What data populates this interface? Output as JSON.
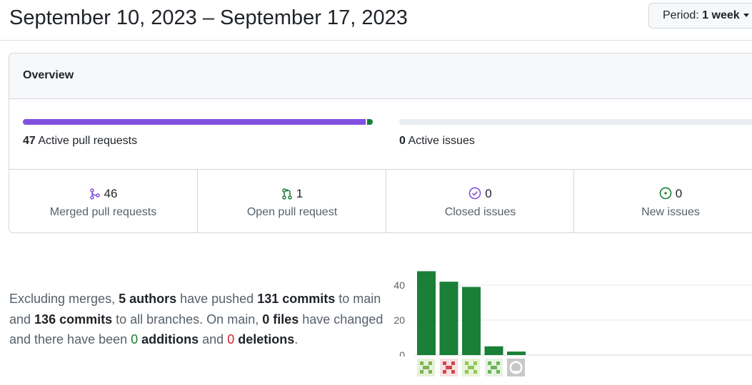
{
  "header": {
    "title": "September 10, 2023 – September 17, 2023",
    "period_label": "Period:",
    "period_value": "1 week"
  },
  "overview": {
    "title": "Overview",
    "pull_requests": {
      "count": "47",
      "label": "Active pull requests",
      "merged": 46,
      "open": 1
    },
    "issues": {
      "count": "0",
      "label": "Active issues"
    },
    "stats": [
      {
        "icon": "git-merge-icon",
        "color": "#8250df",
        "value": "46",
        "label": "Merged pull requests"
      },
      {
        "icon": "git-pull-request-icon",
        "color": "#1a7f37",
        "value": "1",
        "label": "Open pull request"
      },
      {
        "icon": "issue-closed-icon",
        "color": "#8250df",
        "value": "0",
        "label": "Closed issues"
      },
      {
        "icon": "issue-opened-icon",
        "color": "#1a7f37",
        "value": "0",
        "label": "New issues"
      }
    ]
  },
  "commits": {
    "p1": "Excluding merges, ",
    "authors": "5 authors",
    "p2": " have pushed ",
    "main_commits": "131 commits",
    "p3": " to main and ",
    "all_commits": "136 commits",
    "p4": " to all branches. On main, ",
    "files": "0 files",
    "p5": " have changed and there have been ",
    "additions_num": "0",
    "additions_word": " additions",
    "p6": " and ",
    "deletions_num": "0",
    "deletions_word": " deletions",
    "p7": "."
  },
  "chart_data": {
    "type": "bar",
    "series": [
      {
        "values": [
          48,
          42,
          39,
          5,
          2
        ]
      }
    ],
    "ylim": [
      0,
      50
    ],
    "yticks": [
      0,
      20,
      40
    ],
    "grid": true,
    "bar_color": "#1a7f37",
    "avatars": [
      {
        "name": "avatar-contributor-1",
        "bg": "#e6f2d6",
        "fg": "#7fb05a"
      },
      {
        "name": "avatar-contributor-2",
        "bg": "#f7e1e1",
        "fg": "#d2464a"
      },
      {
        "name": "avatar-contributor-3",
        "bg": "#e9f4d5",
        "fg": "#8fc45c"
      },
      {
        "name": "avatar-contributor-4",
        "bg": "#e6f4e2",
        "fg": "#6cb35a"
      },
      {
        "name": "avatar-github-bot",
        "bg": "#c8c8c8",
        "fg": "#ffffff"
      }
    ]
  }
}
